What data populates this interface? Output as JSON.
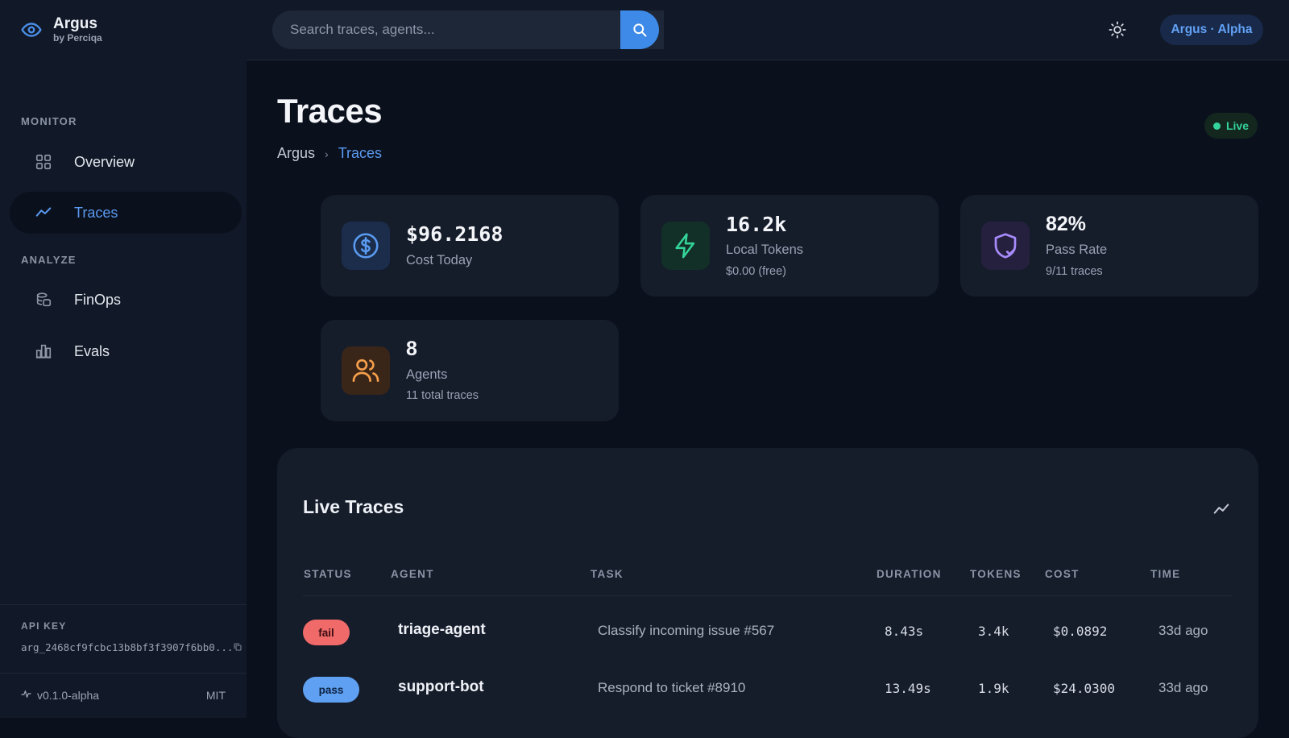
{
  "brand": {
    "name": "Argus",
    "sub": "by Perciqa"
  },
  "search": {
    "placeholder": "Search traces, agents..."
  },
  "header": {
    "badge": "Argus · Alpha"
  },
  "sidebar": {
    "sections": [
      {
        "label": "MONITOR",
        "items": [
          {
            "label": "Overview",
            "icon": "grid-icon"
          },
          {
            "label": "Traces",
            "icon": "trend-icon",
            "active": true
          }
        ]
      },
      {
        "label": "ANALYZE",
        "items": [
          {
            "label": "FinOps",
            "icon": "database-icon"
          },
          {
            "label": "Evals",
            "icon": "bar-chart-icon"
          }
        ]
      }
    ],
    "api_key": {
      "label": "API KEY",
      "value": "arg_2468cf9fcbc13b8bf3f3907f6bb0..."
    },
    "version": "v0.1.0-alpha",
    "license": "MIT"
  },
  "page": {
    "title": "Traces",
    "breadcrumb": [
      "Argus",
      "Traces"
    ],
    "live_label": "Live"
  },
  "stats": [
    {
      "value": "$96.2168",
      "label": "Cost Today",
      "sub": "",
      "icon": "dollar-icon",
      "color": "#5a9af0"
    },
    {
      "value": "16.2k",
      "label": "Local Tokens",
      "sub": "$0.00 (free)",
      "icon": "bolt-icon",
      "color": "#34d399"
    },
    {
      "value": "82%",
      "label": "Pass Rate",
      "sub": "9/11 traces",
      "icon": "shield-check-icon",
      "color": "#a78bfa"
    },
    {
      "value": "8",
      "label": "Agents",
      "sub": "11 total traces",
      "icon": "users-icon",
      "color": "#f59e4b"
    }
  ],
  "live_traces": {
    "title": "Live Traces",
    "columns": [
      "STATUS",
      "AGENT",
      "TASK",
      "DURATION",
      "TOKENS",
      "COST",
      "TIME"
    ],
    "rows": [
      {
        "status": "fail",
        "agent": "triage-agent",
        "task": "Classify incoming issue #567",
        "duration": "8.43s",
        "tokens": "3.4k",
        "cost": "$0.0892",
        "time": "33d ago"
      },
      {
        "status": "pass",
        "agent": "support-bot",
        "task": "Respond to ticket #8910",
        "duration": "13.49s",
        "tokens": "1.9k",
        "cost": "$24.0300",
        "time": "33d ago"
      }
    ]
  }
}
